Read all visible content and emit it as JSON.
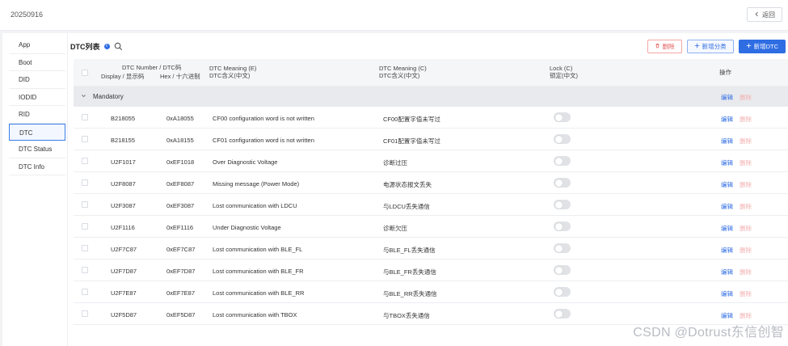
{
  "header": {
    "title": "20250916",
    "back_label": "返回"
  },
  "sidebar": {
    "items": [
      {
        "label": "App",
        "active": false
      },
      {
        "label": "Boot",
        "active": false
      },
      {
        "label": "DID",
        "active": false
      },
      {
        "label": "IODID",
        "active": false
      },
      {
        "label": "RID",
        "active": false
      },
      {
        "label": "DTC",
        "active": true
      },
      {
        "label": "DTC Status",
        "active": false
      },
      {
        "label": "DTC Info",
        "active": false
      }
    ]
  },
  "list": {
    "title": "DTC列表",
    "info_icon": "i",
    "delete_label": "删除",
    "add_category_label": "新增分类",
    "add_dtc_label": "新增DTC"
  },
  "table": {
    "headers": {
      "dtc_number": "DTC Number / DTC码",
      "display": "Display / 显示码",
      "hex": "Hex / 十六进制",
      "meaning_e_1": "DTC Meaning (E)",
      "meaning_e_2": "DTC含义(中文)",
      "meaning_c_1": "DTC Meaning (C)",
      "meaning_c_2": "DTC含义(中文)",
      "lock_1": "Lock (C)",
      "lock_2": "锁定(中文)",
      "ops": "操作"
    },
    "group": {
      "name": "Mandatory",
      "edit": "编辑",
      "delete": "删除"
    },
    "edit_label": "编辑",
    "delete_label": "删除",
    "rows": [
      {
        "display": "B218055",
        "hex": "0xA18055",
        "meaning_e": "CF00 configuration word is not written",
        "meaning_c": "CF00配置字值未写过",
        "locked": false
      },
      {
        "display": "B218155",
        "hex": "0xA18155",
        "meaning_e": "CF01 configuration word is not written",
        "meaning_c": "CF01配置字值未写过",
        "locked": false
      },
      {
        "display": "U2F1017",
        "hex": "0xEF1018",
        "meaning_e": "Over Diagnostic Voltage",
        "meaning_c": "诊断过压",
        "locked": false
      },
      {
        "display": "U2F8087",
        "hex": "0xEF8087",
        "meaning_e": "Missing message (Power Mode)",
        "meaning_c": "电源状态报文丢失",
        "locked": false
      },
      {
        "display": "U2F3087",
        "hex": "0xEF3087",
        "meaning_e": "Lost communication with LDCU",
        "meaning_c": "与LDCU丢失通信",
        "locked": false
      },
      {
        "display": "U2F1116",
        "hex": "0xEF1116",
        "meaning_e": "Under Diagnostic Voltage",
        "meaning_c": "诊断欠压",
        "locked": false
      },
      {
        "display": "U2F7C87",
        "hex": "0xEF7C87",
        "meaning_e": "Lost communication with BLE_FL",
        "meaning_c": "与BLE_FL丢失通信",
        "locked": false
      },
      {
        "display": "U2F7D87",
        "hex": "0xEF7D87",
        "meaning_e": "Lost communication with BLE_FR",
        "meaning_c": "与BLE_FR丢失通信",
        "locked": false
      },
      {
        "display": "U2F7E87",
        "hex": "0xEF7E87",
        "meaning_e": "Lost communication with BLE_RR",
        "meaning_c": "与BLE_RR丢失通信",
        "locked": false
      },
      {
        "display": "U2F5D87",
        "hex": "0xEF5D87",
        "meaning_e": "Lost communication with TBOX",
        "meaning_c": "与TBOX丢失通信",
        "locked": false
      }
    ]
  },
  "watermark": "CSDN @Dotrust东信创智",
  "colors": {
    "accent": "#2f6de3",
    "danger": "#e45858",
    "group_bg": "#e9eaee"
  }
}
